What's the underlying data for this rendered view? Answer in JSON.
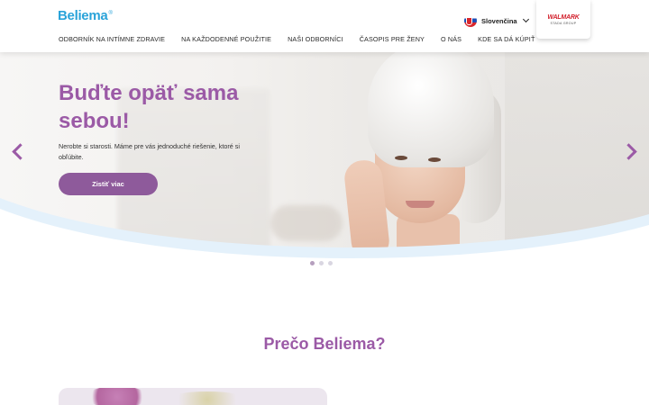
{
  "brand": {
    "logo_text": "Beliema",
    "logo_mark": "®",
    "accent": "#9b5aa6",
    "logo_color": "#2aa3d9"
  },
  "nav": {
    "items": [
      {
        "label": "ODBORNÍK NA INTÍMNE ZDRAVIE"
      },
      {
        "label": "NA KAŽDODENNÉ POUŽITIE"
      },
      {
        "label": "NAŠI ODBORNÍCI"
      },
      {
        "label": "ČASOPIS PRE ŽENY"
      },
      {
        "label": "O NÁS"
      },
      {
        "label": "KDE SA DÁ KÚPIŤ"
      }
    ]
  },
  "language": {
    "label": "Slovenčina",
    "flag_icon": "slovakia-flag-icon"
  },
  "partner": {
    "name": "WALMARK",
    "sub": "STADA GROUP"
  },
  "hero": {
    "title": "Buďte opäť sama sebou!",
    "text": "Nerobte si starosti. Máme pre vás jednoduché riešenie, ktoré si obľúbite.",
    "cta_label": "Zistiť viac",
    "slides": 3,
    "active_slide": 1
  },
  "section": {
    "title": "Prečo Beliema?"
  }
}
